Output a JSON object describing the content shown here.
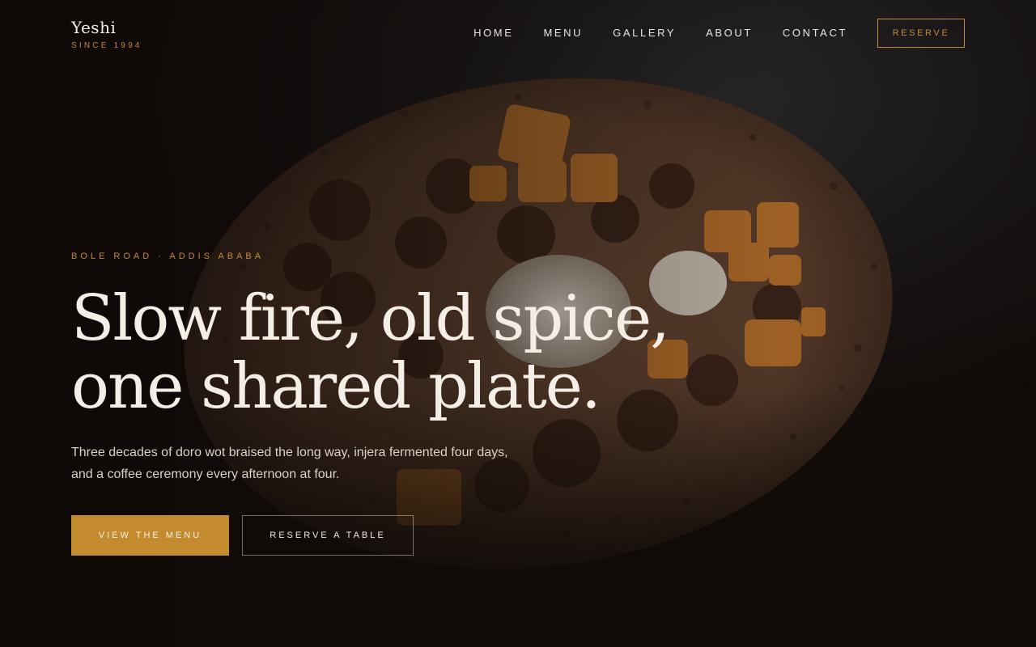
{
  "brand": {
    "name": "Yeshi",
    "tagline": "SINCE 1994"
  },
  "nav": {
    "items": [
      {
        "label": "HOME"
      },
      {
        "label": "MENU"
      },
      {
        "label": "GALLERY"
      },
      {
        "label": "ABOUT"
      },
      {
        "label": "CONTACT"
      }
    ],
    "reserve_label": "RESERVE"
  },
  "hero": {
    "eyebrow": "BOLE ROAD · ADDIS ABABA",
    "headline_line1": "Slow fire, old spice,",
    "headline_line2": "one shared plate.",
    "lede": "Three decades of doro wot braised the long way, injera fermented four days, and a coffee ceremony every afternoon at four.",
    "primary_cta": "VIEW THE MENU",
    "secondary_cta": "RESERVE A TABLE",
    "image": "injera-platter-photo"
  },
  "colors": {
    "accent": "#c48a3a",
    "button_fill": "#c48a2e",
    "background": "#120c09",
    "text": "#f4eee6"
  }
}
